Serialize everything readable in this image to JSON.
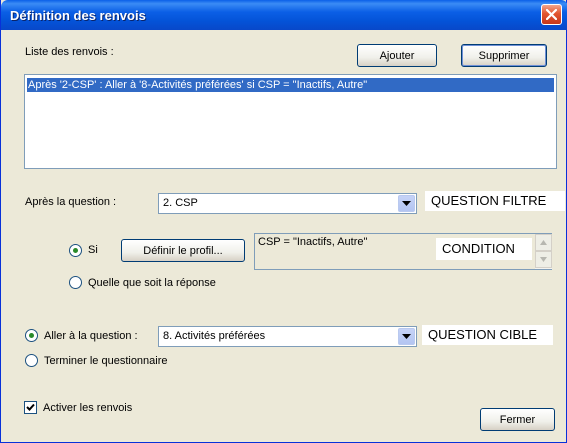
{
  "window": {
    "title": "Définition des renvois"
  },
  "list": {
    "label": "Liste des renvois :",
    "add_label": "Ajouter",
    "delete_label": "Supprimer",
    "items": [
      "Après '2-CSP' : Aller à '8-Activités préférées'  si CSP = \"Inactifs, Autre\""
    ]
  },
  "filter": {
    "label": "Après la question :",
    "selected": "2. CSP",
    "tag": "QUESTION FILTRE"
  },
  "condition": {
    "si_label": "Si",
    "profile_button": "Définir le profil...",
    "text": "CSP = \"Inactifs, Autre\"",
    "tag": "CONDITION",
    "any_answer_label": "Quelle que soit la réponse",
    "si_checked": true,
    "any_answer_checked": false
  },
  "target": {
    "goto_label": "Aller à la question :",
    "selected": "8. Activités préférées",
    "tag": "QUESTION CIBLE",
    "end_label": "Terminer le questionnaire",
    "goto_checked": true,
    "end_checked": false
  },
  "footer": {
    "enable_label": "Activer les renvois",
    "enable_checked": true,
    "close_label": "Fermer"
  },
  "icons": {
    "close": "close-icon",
    "dropdown": "chevron-down-icon",
    "scroll_up": "scroll-up-icon",
    "scroll_down": "scroll-down-icon",
    "check": "check-icon"
  },
  "colors": {
    "titlebar": "#0453d8",
    "selection": "#316ac5",
    "dialog_bg": "#ece9d8"
  }
}
